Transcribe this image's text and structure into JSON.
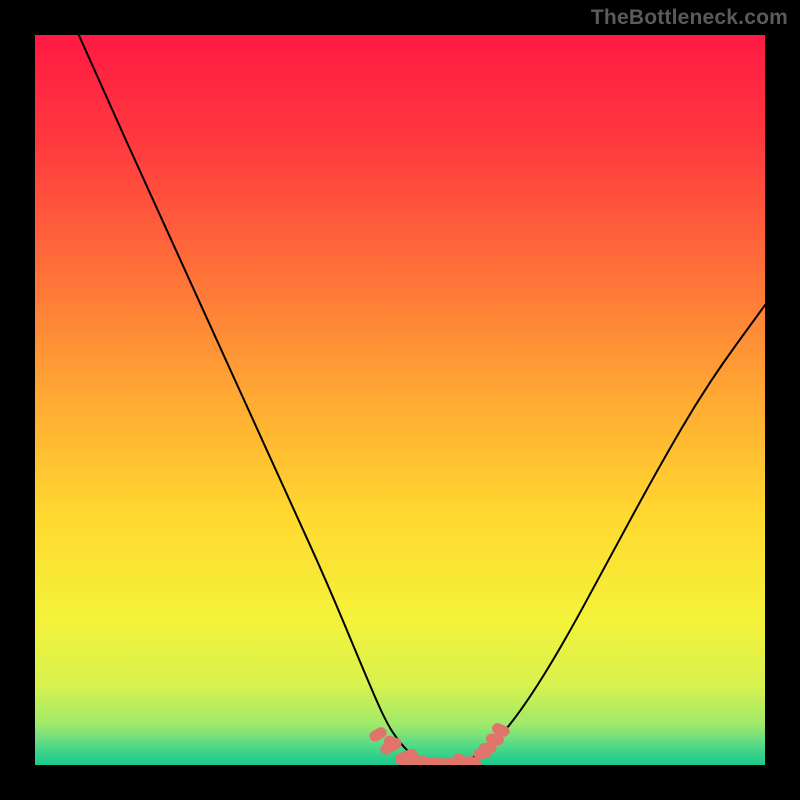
{
  "watermark": "TheBottleneck.com",
  "chart_data": {
    "type": "line",
    "title": "",
    "xlabel": "",
    "ylabel": "",
    "xlim": [
      0,
      100
    ],
    "ylim": [
      0,
      100
    ],
    "series": [
      {
        "name": "bottleneck-curve",
        "x": [
          6,
          10,
          15,
          20,
          25,
          30,
          35,
          40,
          45,
          48,
          50,
          52,
          55,
          58,
          60,
          63,
          67,
          72,
          78,
          85,
          92,
          100
        ],
        "y": [
          100,
          91,
          80,
          69,
          58,
          47,
          36,
          25,
          13,
          6,
          3,
          1,
          0,
          0,
          1,
          3,
          8,
          16,
          27,
          40,
          52,
          63
        ],
        "stroke": "#000000"
      }
    ],
    "markers": {
      "name": "highlight-dots",
      "color": "#e0746b",
      "points": [
        {
          "x": 47,
          "y": 4.2
        },
        {
          "x": 48.5,
          "y": 2.4
        },
        {
          "x": 49,
          "y": 3.1
        },
        {
          "x": 50.5,
          "y": 0.6
        },
        {
          "x": 51.2,
          "y": 1.3
        },
        {
          "x": 52.5,
          "y": 0.4
        },
        {
          "x": 54,
          "y": 0.3
        },
        {
          "x": 55.5,
          "y": 0.2
        },
        {
          "x": 57,
          "y": 0.2
        },
        {
          "x": 58.4,
          "y": 0.6
        },
        {
          "x": 60,
          "y": 0.3
        },
        {
          "x": 61.3,
          "y": 1.6
        },
        {
          "x": 62,
          "y": 2.3
        },
        {
          "x": 63,
          "y": 3.5
        },
        {
          "x": 63.8,
          "y": 4.8
        }
      ]
    },
    "gradient_stops": [
      {
        "offset": 0.0,
        "color": "#ff1a44"
      },
      {
        "offset": 0.15,
        "color": "#ff3a3e"
      },
      {
        "offset": 0.32,
        "color": "#ff6f39"
      },
      {
        "offset": 0.5,
        "color": "#ffaa33"
      },
      {
        "offset": 0.66,
        "color": "#ffd930"
      },
      {
        "offset": 0.8,
        "color": "#f4f23a"
      },
      {
        "offset": 0.89,
        "color": "#d8f24e"
      },
      {
        "offset": 0.945,
        "color": "#9fe96b"
      },
      {
        "offset": 0.975,
        "color": "#4fd889"
      },
      {
        "offset": 1.0,
        "color": "#17c98a"
      }
    ],
    "plot_size": 730
  }
}
